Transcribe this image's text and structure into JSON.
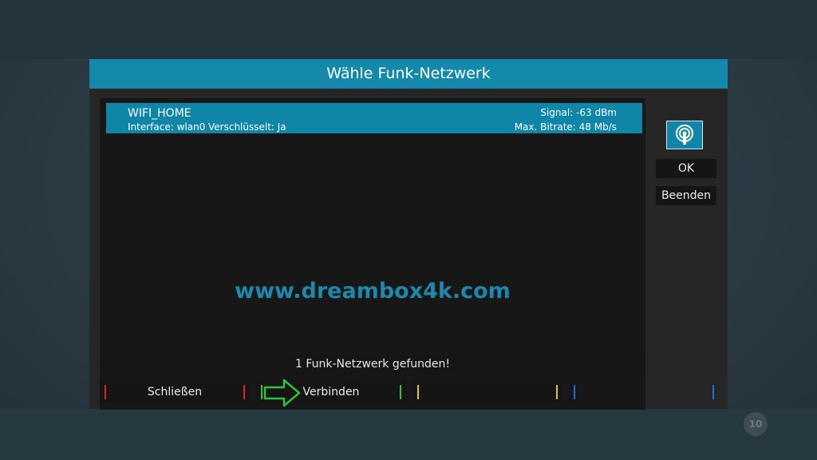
{
  "dialog": {
    "title": "Wähle Funk-Netzwerk"
  },
  "network": {
    "ssid": "WIFI_HOME",
    "signal": "Signal: -63 dBm",
    "interface": "Interface: wlan0",
    "encrypted": "Verschlüsselt: Ja",
    "bitrate": "Max. Bitrate: 48 Mb/s"
  },
  "watermark": "www.dreambox4k.com",
  "status": "1 Funk-Netzwerk gefunden!",
  "side": {
    "icon": "wifi-icon",
    "ok_label": "OK",
    "quit_label": "Beenden"
  },
  "color_buttons": {
    "red_label": "Schließen",
    "green_label": "Verbinden",
    "yellow_label": "",
    "blue_label": ""
  },
  "colors": {
    "accent": "#1589ab",
    "red": "#d62828",
    "green": "#2fc23a",
    "yellow": "#e6c32a",
    "blue": "#1e6fd6"
  },
  "badge": "10"
}
